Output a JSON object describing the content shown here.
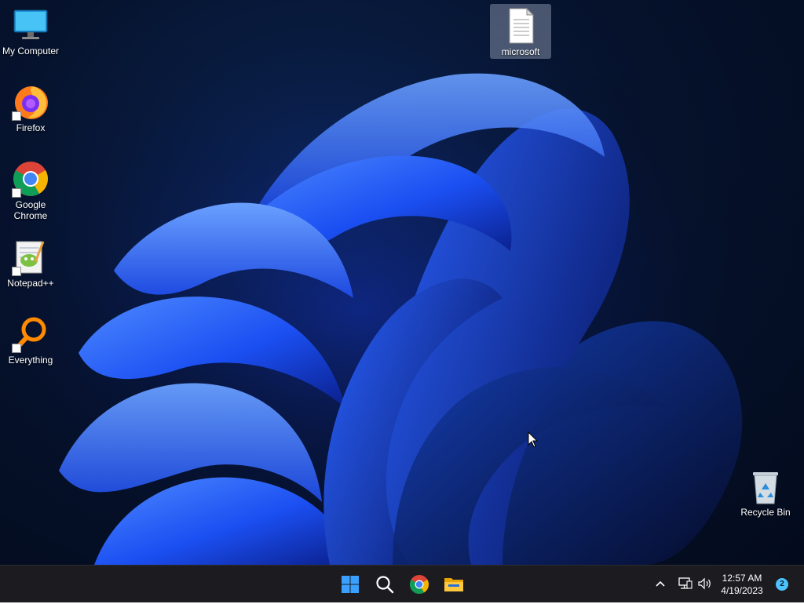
{
  "desktop": {
    "icons": [
      {
        "label": "My Computer",
        "icon": "monitor-icon",
        "shortcut": false
      },
      {
        "label": "Firefox",
        "icon": "firefox-icon",
        "shortcut": true
      },
      {
        "label": "Google Chrome",
        "icon": "chrome-icon",
        "shortcut": true
      },
      {
        "label": "Notepad++",
        "icon": "notepadpp-icon",
        "shortcut": true
      },
      {
        "label": "Everything",
        "icon": "everything-search-icon",
        "shortcut": true
      },
      {
        "label": "microsoft",
        "icon": "text-document-icon",
        "shortcut": false,
        "selected": true
      },
      {
        "label": "Recycle Bin",
        "icon": "recycle-bin-icon",
        "shortcut": false
      }
    ]
  },
  "taskbar": {
    "pinned": [
      {
        "name": "Start",
        "icon": "windows-start-icon"
      },
      {
        "name": "Search",
        "icon": "search-icon"
      },
      {
        "name": "Google Chrome",
        "icon": "chrome-icon"
      },
      {
        "name": "File Explorer",
        "icon": "folder-icon"
      }
    ],
    "tray": {
      "overflow_icon": "chevron-up-icon",
      "network_icon": "network-icon",
      "volume_icon": "volume-icon",
      "time": "12:57 AM",
      "date": "4/19/2023",
      "notification_count": "2"
    }
  },
  "colors": {
    "taskbar_bg": "#1c1c20",
    "accent": "#4cc2ff",
    "wallpaper_dark": "#030a1c",
    "wallpaper_blue": "#1f5cff"
  }
}
